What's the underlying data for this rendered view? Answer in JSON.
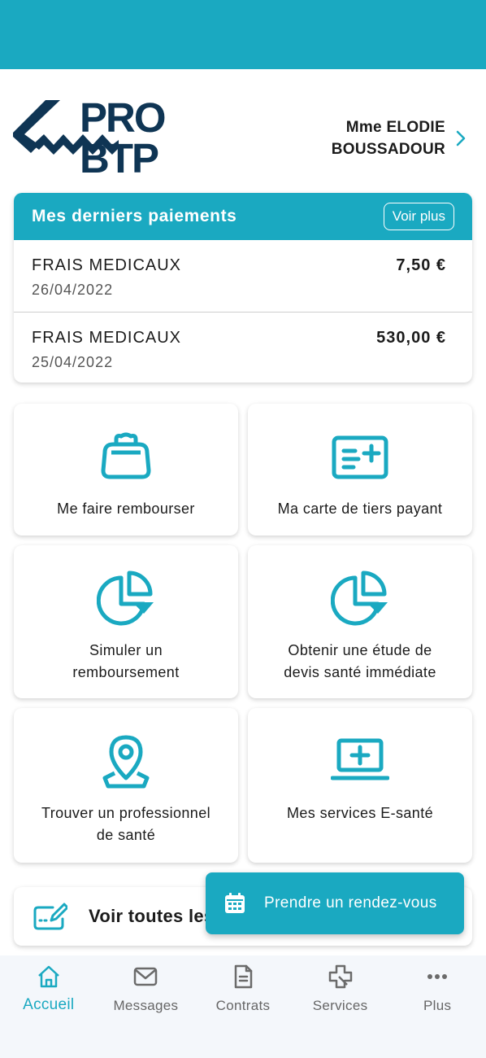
{
  "brand": {
    "name": "PRO BTP",
    "color": "#0f3554",
    "accent": "#1aa9c1"
  },
  "user": {
    "line1": "Mme ELODIE",
    "line2": "BOUSSADOUR"
  },
  "payments": {
    "title": "Mes derniers paiements",
    "more_label": "Voir plus",
    "rows": [
      {
        "label": "FRAIS MEDICAUX",
        "date": "26/04/2022",
        "amount": "7,50 €"
      },
      {
        "label": "FRAIS MEDICAUX",
        "date": "25/04/2022",
        "amount": "530,00 €"
      }
    ]
  },
  "tiles": [
    {
      "label": "Me faire rembourser",
      "icon": "wallet-icon"
    },
    {
      "label": "Ma carte de tiers payant",
      "icon": "card-plus-icon"
    },
    {
      "label": "Simuler un remboursement",
      "icon": "pie-chart-icon"
    },
    {
      "label": "Obtenir une étude de devis santé immédiate",
      "icon": "pie-chart-icon"
    },
    {
      "label": "Trouver un professionnel de santé",
      "icon": "location-pin-icon"
    },
    {
      "label": "Mes services E-santé",
      "icon": "laptop-plus-icon"
    }
  ],
  "see_all": {
    "label": "Voir toutes les"
  },
  "fab": {
    "label": "Prendre un rendez-vous"
  },
  "tabs": [
    {
      "label": "Accueil",
      "icon": "home-icon"
    },
    {
      "label": "Messages",
      "icon": "mail-icon"
    },
    {
      "label": "Contrats",
      "icon": "document-icon"
    },
    {
      "label": "Services",
      "icon": "medical-cross-icon"
    },
    {
      "label": "Plus",
      "icon": "more-dots-icon"
    }
  ]
}
